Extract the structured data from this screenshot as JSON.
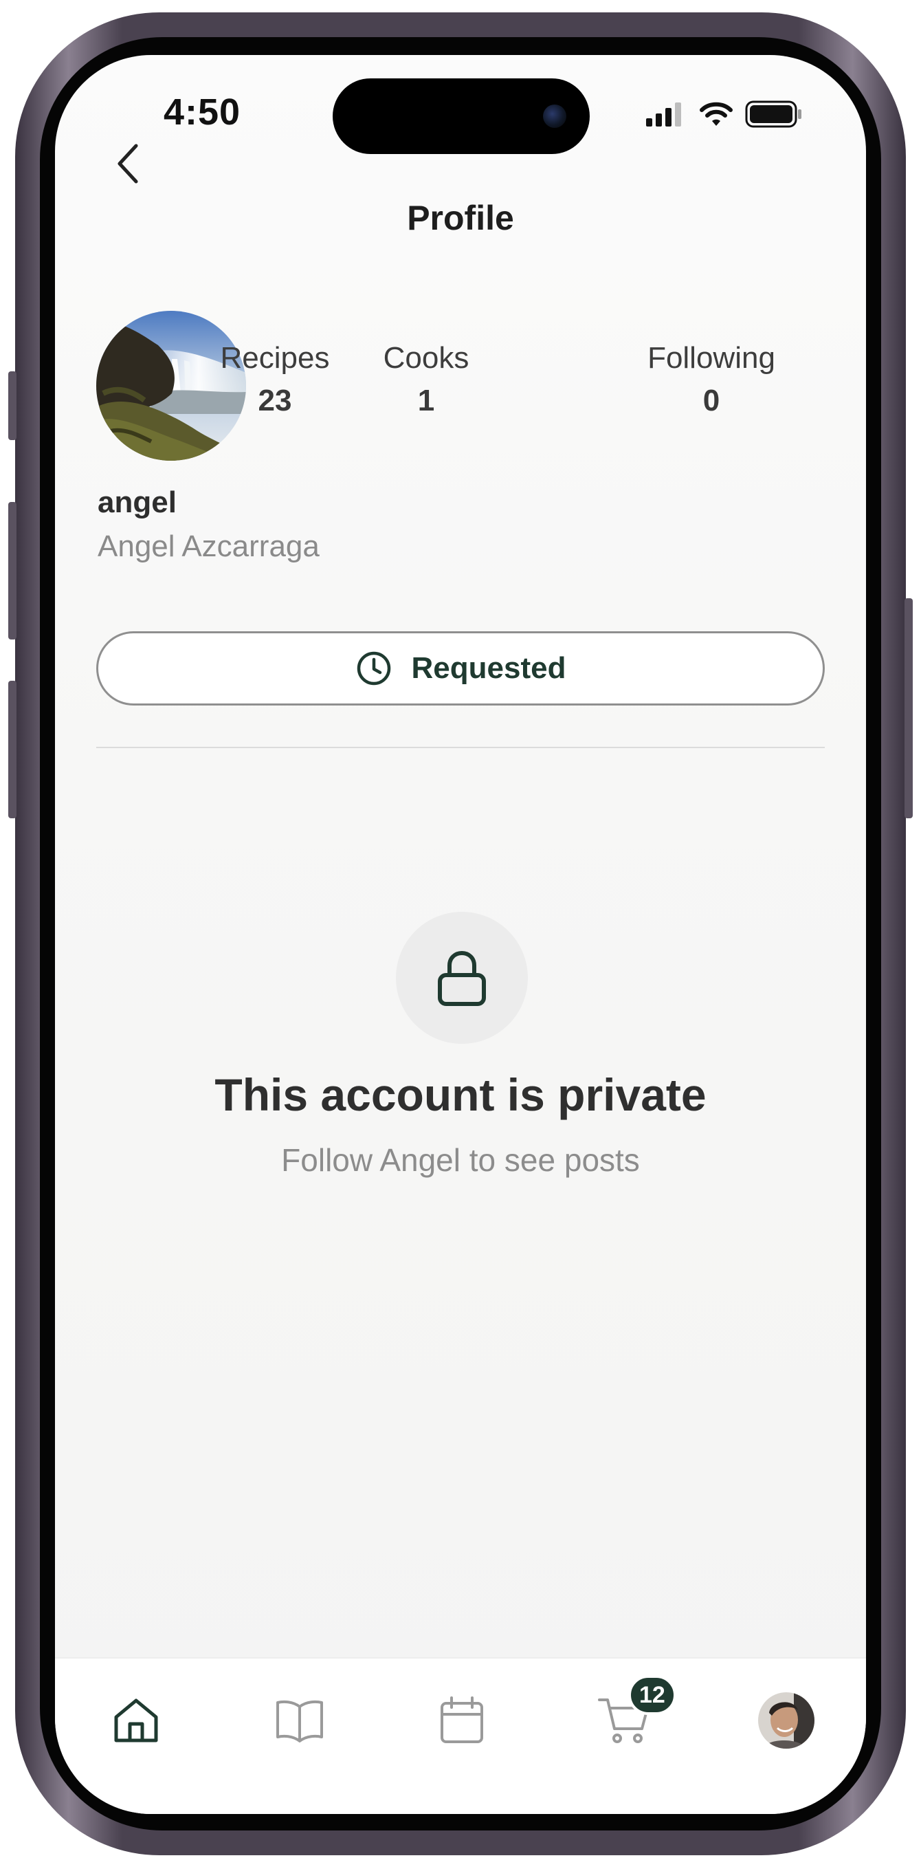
{
  "status_bar": {
    "time": "4:50"
  },
  "header": {
    "title": "Profile",
    "back_icon": "chevron-left-icon"
  },
  "profile": {
    "username": "angel",
    "full_name": "Angel Azcarraga",
    "stats": [
      {
        "label": "Recipes",
        "value": "23"
      },
      {
        "label": "Cooks",
        "value": "1"
      },
      {
        "label": "Following",
        "value": "0"
      }
    ],
    "request_button": {
      "label": "Requested",
      "icon": "clock-icon"
    }
  },
  "private_notice": {
    "icon": "lock-icon",
    "title": "This account is private",
    "subtitle": "Follow Angel to see posts"
  },
  "tab_bar": {
    "items": [
      {
        "name": "home",
        "icon": "home-icon",
        "active": true
      },
      {
        "name": "recipes",
        "icon": "book-icon",
        "active": false
      },
      {
        "name": "planner",
        "icon": "calendar-icon",
        "active": false
      },
      {
        "name": "cart",
        "icon": "cart-icon",
        "active": false,
        "badge": "12"
      },
      {
        "name": "profile",
        "icon": "avatar",
        "active": false
      }
    ]
  },
  "colors": {
    "accent": "#1f3a30",
    "text_primary": "#2e2e2e",
    "text_secondary": "#8a8a8a",
    "screen_bg": "#f7f7f6"
  }
}
